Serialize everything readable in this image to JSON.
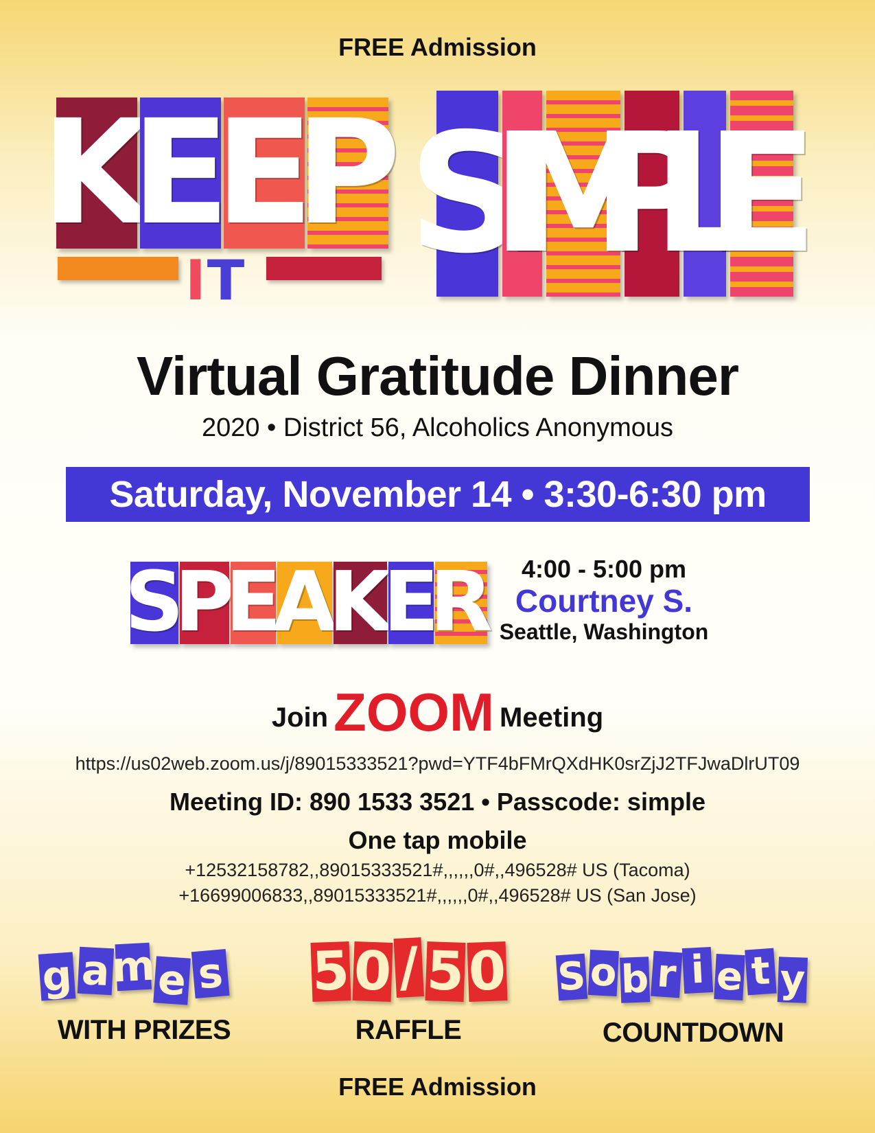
{
  "admission": {
    "top": "FREE Admission",
    "bottom": "FREE Admission"
  },
  "logo": {
    "keep": [
      "K",
      "E",
      "E",
      "P"
    ],
    "it": [
      "I",
      "T"
    ],
    "simple": [
      "S",
      "I",
      "M",
      "P",
      "L",
      "E"
    ]
  },
  "event": {
    "title": "Virtual Gratitude Dinner",
    "subtitle": "2020 • District 56, Alcoholics Anonymous",
    "date_time": "Saturday, November 14 • 3:30-6:30 pm"
  },
  "speaker": {
    "heading_letters": [
      "S",
      "P",
      "E",
      "A",
      "K",
      "E",
      "R"
    ],
    "time": "4:00 - 5:00 pm",
    "name": "Courtney S.",
    "location": "Seattle, Washington"
  },
  "zoom": {
    "join_prefix": "Join",
    "zoom_word": "ZOOM",
    "join_suffix": "Meeting",
    "url": "https://us02web.zoom.us/j/89015333521?pwd=YTF4bFMrQXdHK0srZjJ2TFJwaDlrUT09",
    "meeting_line": "Meeting ID: 890 1533 3521 •  Passcode: simple",
    "one_tap_label": "One tap mobile",
    "tap_numbers": [
      "+12532158782,,89015333521#,,,,,,0#,,496528# US (Tacoma)",
      "+16699006833,,89015333521#,,,,,,0#,,496528# US (San Jose)"
    ]
  },
  "features": {
    "games_letters": [
      "g",
      "a",
      "m",
      "e",
      "s"
    ],
    "games_caption": "WITH PRIZES",
    "raffle_letters": [
      "5",
      "0",
      "/",
      "5",
      "0"
    ],
    "raffle_caption": "RAFFLE",
    "sobriety_letters": [
      "S",
      "o",
      "b",
      "r",
      "i",
      "e",
      "t",
      "y"
    ],
    "sobriety_caption": "COUNTDOWN"
  },
  "colors": {
    "accent_blue": "#4338d6",
    "zoom_red": "#e11d2a",
    "background_gold": "#f6d774"
  }
}
